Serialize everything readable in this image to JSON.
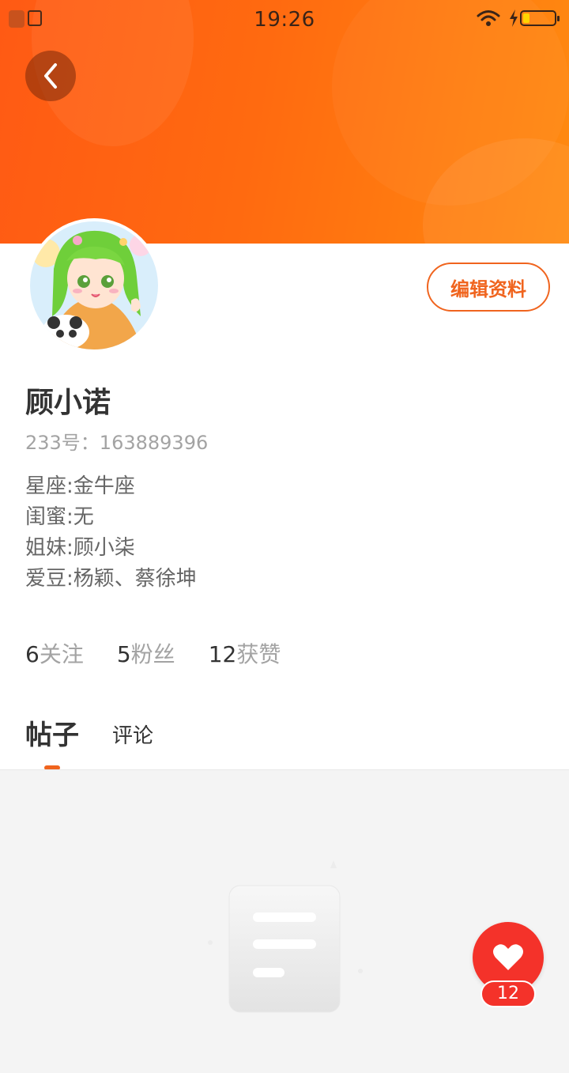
{
  "status_bar": {
    "time": "19:26"
  },
  "profile": {
    "name": "顾小诺",
    "id_text": "233号：163889396",
    "bio": [
      "星座:金牛座",
      "闺蜜:无",
      "姐妹:顾小柒",
      "爱豆:杨颖、蔡徐坤"
    ],
    "edit_button_label": "编辑资料"
  },
  "stats": {
    "following_count": "6",
    "following_label": "关注",
    "followers_count": "5",
    "followers_label": "粉丝",
    "likes_count": "12",
    "likes_label": "获赞"
  },
  "tabs": {
    "posts": "帖子",
    "comments": "评论",
    "active": "posts"
  },
  "like_fab": {
    "count": "12"
  },
  "colors": {
    "accent": "#f0641e",
    "header_start": "#ff5a14",
    "header_end": "#ff8a10",
    "like_red": "#f4322a"
  },
  "icons": {
    "back": "chevron-left-icon",
    "like": "heart-icon",
    "empty": "empty-document-icon"
  }
}
